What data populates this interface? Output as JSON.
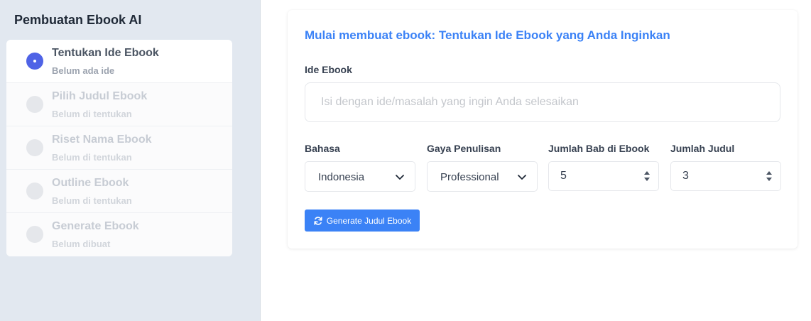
{
  "sidebar": {
    "title": "Pembuatan Ebook AI",
    "steps": [
      {
        "title": "Tentukan Ide Ebook",
        "subtitle": "Belum ada ide",
        "state": "active"
      },
      {
        "title": "Pilih Judul Ebook",
        "subtitle": "Belum di tentukan",
        "state": "disabled"
      },
      {
        "title": "Riset Nama Ebook",
        "subtitle": "Belum di tentukan",
        "state": "disabled"
      },
      {
        "title": "Outline Ebook",
        "subtitle": "Belum di tentukan",
        "state": "disabled"
      },
      {
        "title": "Generate Ebook",
        "subtitle": "Belum dibuat",
        "state": "disabled"
      }
    ]
  },
  "main": {
    "heading": "Mulai membuat ebook: Tentukan Ide Ebook yang Anda Inginkan",
    "idea": {
      "label": "Ide Ebook",
      "value": "",
      "placeholder": "Isi dengan ide/masalah yang ingin Anda selesaikan"
    },
    "language": {
      "label": "Bahasa",
      "value": "Indonesia"
    },
    "style": {
      "label": "Gaya Penulisan",
      "value": "Professional"
    },
    "chapters": {
      "label": "Jumlah Bab di Ebook",
      "value": "5"
    },
    "titles": {
      "label": "Jumlah Judul",
      "value": "3"
    },
    "generate_button": "Generate Judul Ebook"
  },
  "colors": {
    "accent": "#3b82f6",
    "active_step": "#4f63e6",
    "sidebar_bg": "#e2e8f0"
  },
  "icons": {
    "active_step": "radio-dot-icon",
    "select": "chevron-down-icon",
    "number": "spinner-arrows-icon",
    "generate": "refresh-icon"
  }
}
